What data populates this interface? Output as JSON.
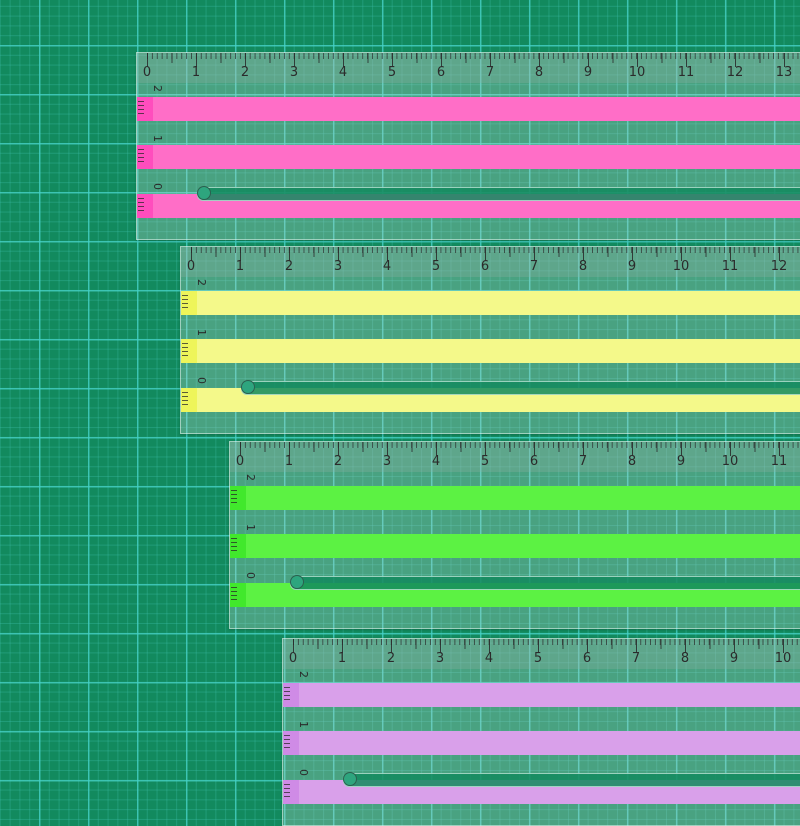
{
  "scene": "rulers-on-cutting-mat",
  "mat_colors": {
    "base": "#128a5e",
    "grid_line": "#2fc7b9"
  },
  "rulers": [
    {
      "name": "pink",
      "color": "#ff6ec7",
      "tab_color": "#ff4dbd",
      "numbers": [
        "0",
        "1",
        "2",
        "3",
        "4",
        "5",
        "6",
        "7",
        "8",
        "9",
        "10",
        "11",
        "12",
        "13"
      ],
      "band_labels": [
        "2",
        "1",
        "0"
      ]
    },
    {
      "name": "yellow",
      "color": "#f4f98a",
      "tab_color": "#eef55a",
      "numbers": [
        "0",
        "1",
        "2",
        "3",
        "4",
        "5",
        "6",
        "7",
        "8",
        "9",
        "10",
        "11",
        "12"
      ],
      "band_labels": [
        "2",
        "1",
        "0"
      ]
    },
    {
      "name": "green",
      "color": "#5cf243",
      "tab_color": "#41e82c",
      "numbers": [
        "0",
        "1",
        "2",
        "3",
        "4",
        "5",
        "6",
        "7",
        "8",
        "9",
        "10",
        "11"
      ],
      "band_labels": [
        "2",
        "1",
        "0"
      ]
    },
    {
      "name": "purple",
      "color": "#d9a0ea",
      "tab_color": "#cf8be6",
      "numbers": [
        "0",
        "1",
        "2",
        "3",
        "4",
        "5",
        "6",
        "7",
        "8",
        "9",
        "10"
      ],
      "band_labels": [
        "2",
        "1",
        "0"
      ]
    }
  ]
}
